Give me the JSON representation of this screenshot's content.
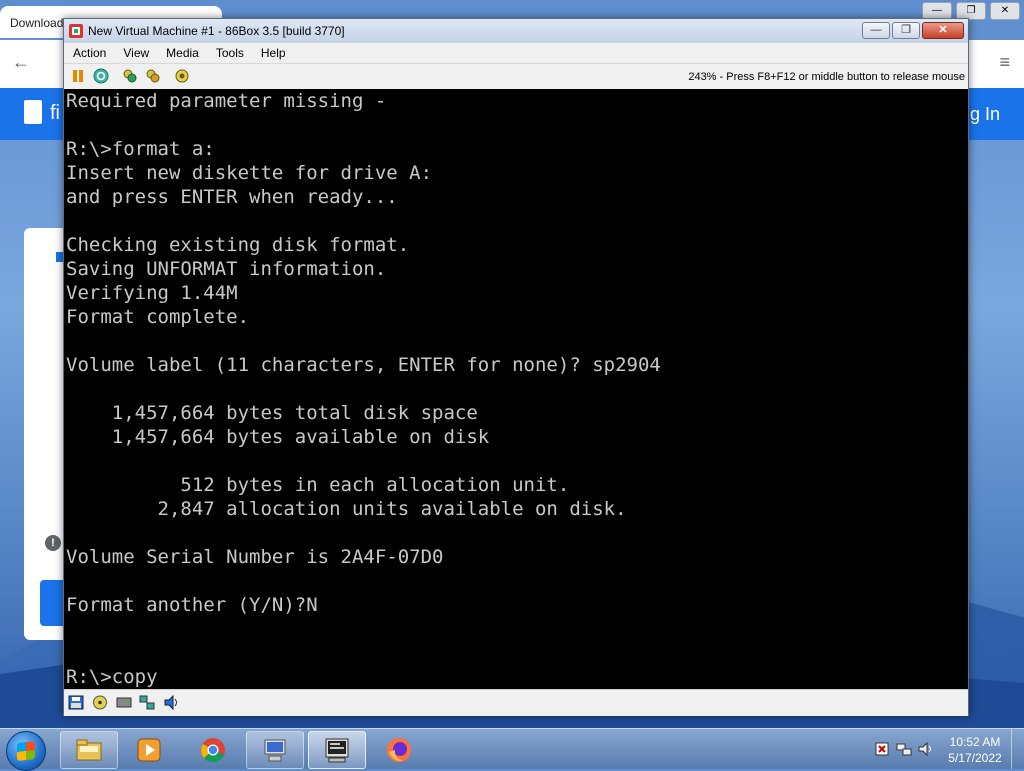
{
  "browser": {
    "tab_title": "Download",
    "header_left_text": "fi",
    "header_right_text": "g In",
    "alert_glyph": "!",
    "back_glyph": "←",
    "menu_glyph": "≡"
  },
  "vm": {
    "title": "New Virtual Machine #1 - 86Box 3.5 [build 3770]",
    "window_buttons": {
      "minimize": "—",
      "restore": "❐",
      "close": "✕"
    },
    "menu": [
      "Action",
      "View",
      "Media",
      "Tools",
      "Help"
    ],
    "status_text": "243% - Press F8+F12 or middle button to release mouse",
    "console_lines": [
      "Required parameter missing -",
      "",
      "R:\\>format a:",
      "Insert new diskette for drive A:",
      "and press ENTER when ready...",
      "",
      "Checking existing disk format.",
      "Saving UNFORMAT information.",
      "Verifying 1.44M",
      "Format complete.",
      "",
      "Volume label (11 characters, ENTER for none)? sp2904",
      "",
      "    1,457,664 bytes total disk space",
      "    1,457,664 bytes available on disk",
      "",
      "          512 bytes in each allocation unit.",
      "        2,847 allocation units available on disk.",
      "",
      "Volume Serial Number is 2A4F-07D0",
      "",
      "Format another (Y/N)?N",
      "",
      "",
      "R:\\>copy"
    ]
  },
  "taskbar": {
    "time": "10:52 AM",
    "date": "5/17/2022",
    "apps": [
      "file-explorer-icon",
      "media-player-icon",
      "chrome-icon",
      "computer-icon",
      "86box-icon",
      "firefox-icon"
    ]
  },
  "colors": {
    "console_bg": "#000000",
    "console_fg": "#c8c8c8",
    "browser_accent": "#1a73e8"
  }
}
